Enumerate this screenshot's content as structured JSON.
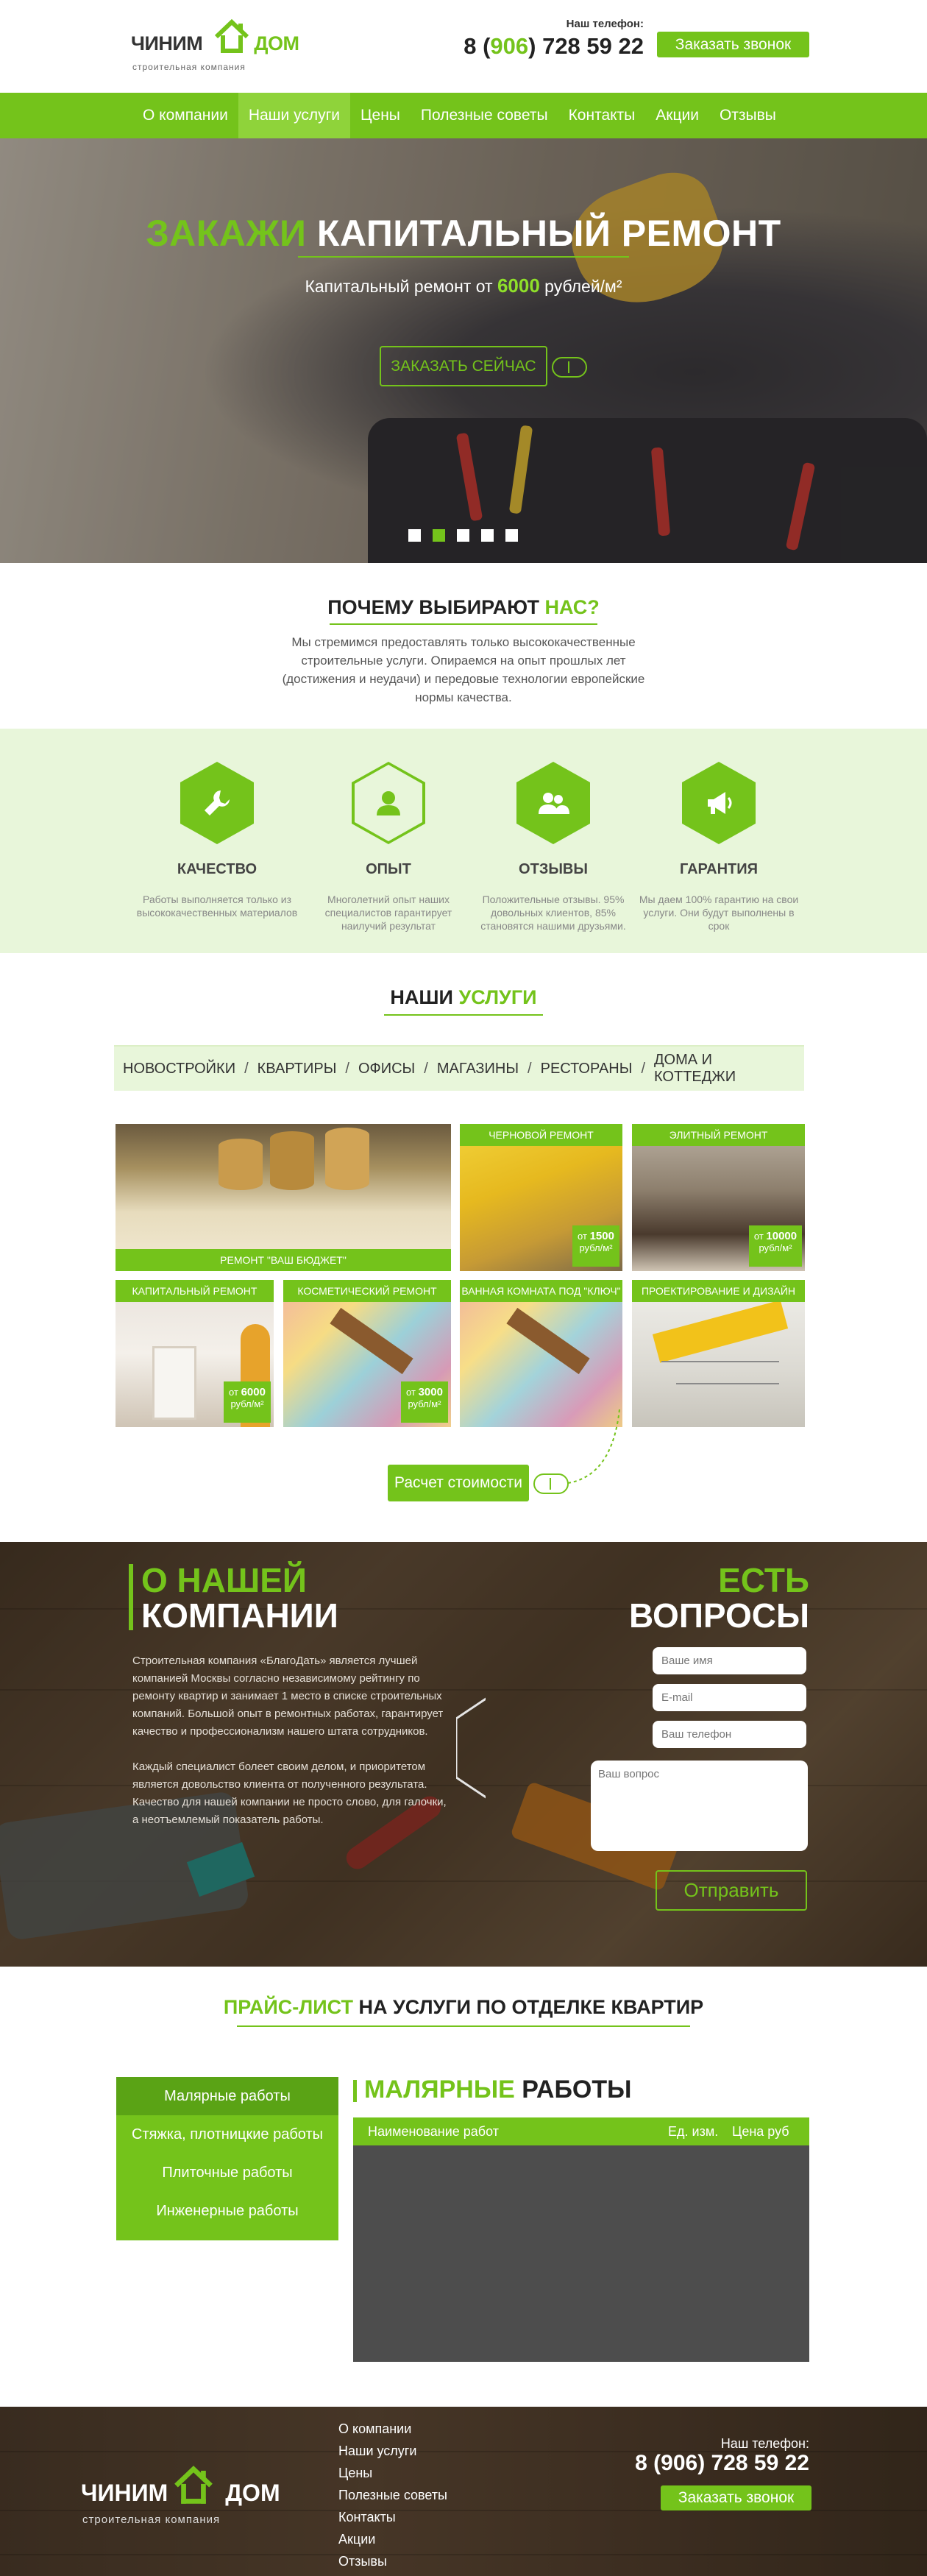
{
  "header": {
    "logo_word1": "ЧИНИМ",
    "logo_word2": "ДОМ",
    "logo_sub": "строительная компания",
    "phone_label": "Наш телефон:",
    "phone_prefix": "8 (",
    "phone_code": "906",
    "phone_rest": ") 728 59 22",
    "call_button": "Заказать звонок"
  },
  "nav": {
    "items": [
      "О компании",
      "Наши услуги",
      "Цены",
      "Полезные советы",
      "Контакты",
      "Акции",
      "Отзывы"
    ],
    "active": "Наши услуги"
  },
  "hero": {
    "title_accent": "ЗАКАЖИ",
    "title_rest": "КАПИТАЛЬНЫЙ РЕМОНТ",
    "sub_prefix": "Капитальный ремонт от",
    "sub_number": "6000",
    "sub_suffix": "рублей/м²",
    "button": "ЗАКАЗАТЬ СЕЙЧАС",
    "slides_total": 5,
    "slide_active": 2
  },
  "why": {
    "title_main": "ПОЧЕМУ ВЫБИРАЮТ",
    "title_accent": "НАС?",
    "text": "Мы стремимся предоставлять только высококачественные строительные услуги. Опираемся на опыт прошлых лет (достижения и неудачи) и передовые технологии европейские нормы качества."
  },
  "features": [
    {
      "icon": "wrench-icon",
      "title": "КАЧЕСТВО",
      "text": "Работы выполняется только из высококачественных материалов"
    },
    {
      "icon": "user-icon",
      "title": "ОПЫТ",
      "text": "Многолетний опыт наших специалистов гарантирует наилучий результат"
    },
    {
      "icon": "users-icon",
      "title": "ОТЗЫВЫ",
      "text": "Положительные отзывы. 95% довольных клиентов, 85% становятся нашими друзьями."
    },
    {
      "icon": "megaphone-icon",
      "title": "ГАРАНТИЯ",
      "text": "Мы даем 100% гарантию на свои услуги. Они будут выполнены в срок"
    }
  ],
  "services": {
    "title_main": "НАШИ",
    "title_accent": "УСЛУГИ",
    "tabs": [
      "НОВОСТРОЙКИ",
      "КВАРТИРЫ",
      "ОФИСЫ",
      "МАГАЗИНЫ",
      "РЕСТОРАНЫ",
      "ДОМА И КОТТЕДЖИ"
    ],
    "tiles": [
      {
        "label": "РЕМОНТ \"ВАШ БЮДЖЕТ\"",
        "price_from": "",
        "price_value": "",
        "price_unit": ""
      },
      {
        "label": "ЧЕРНОВОЙ РЕМОНТ",
        "price_from": "от",
        "price_value": "1500",
        "price_unit": "рубл/м²"
      },
      {
        "label": "ЭЛИТНЫЙ РЕМОНТ",
        "price_from": "от",
        "price_value": "10000",
        "price_unit": "рубл/м²"
      },
      {
        "label": "КАПИТАЛЬНЫЙ РЕМОНТ",
        "price_from": "от",
        "price_value": "6000",
        "price_unit": "рубл/м²"
      },
      {
        "label": "КОСМЕТИЧЕСКИЙ РЕМОНТ",
        "price_from": "от",
        "price_value": "3000",
        "price_unit": "рубл/м²"
      },
      {
        "label": "ВАННАЯ КОМНАТА ПОД \"КЛЮЧ\"",
        "price_from": "",
        "price_value": "",
        "price_unit": ""
      },
      {
        "label": "ПРОЕКТИРОВАНИЕ И ДИЗАЙН",
        "price_from": "",
        "price_value": "",
        "price_unit": ""
      }
    ],
    "calc_button": "Расчет стоимости"
  },
  "about": {
    "title_line1": "О НАШЕЙ",
    "title_line2": "КОМПАНИИ",
    "para1": "Строительная компания «БлагоДать» является лучшей компанией Москвы согласно независимому рейтингу по ремонту квартир и занимает 1 место в списке строительных компаний. Большой опыт в ремонтных работах, гарантирует качество и профессионализм нашего штата сотрудников.",
    "para2": "Каждый специалист болеет своим делом, и приоритетом является довольство клиента от полученного результата. Качество для нашей компании не просто слово, для галочки, а неотъемлемый показатель работы.",
    "q_line1": "ЕСТЬ",
    "q_line2": "ВОПРОСЫ",
    "name_placeholder": "Ваше имя",
    "email_placeholder": "E-mail",
    "phone_placeholder": "Ваш телефон",
    "question_placeholder": "Ваш вопрос",
    "send_button": "Отправить"
  },
  "pricelist": {
    "title_accent": "ПРАЙС-ЛИСТ",
    "title_rest": "НА УСЛУГИ ПО ОТДЕЛКЕ КВАРТИР",
    "menu": [
      "Малярные работы",
      "Стяжка, плотницкие работы",
      "Плиточные работы",
      "Инженерные работы"
    ],
    "menu_active": 0,
    "heading_accent": "МАЛЯРНЫЕ",
    "heading_rest": "РАБОТЫ",
    "col_name": "Наименование работ",
    "col_unit": "Ед. изм.",
    "col_price": "Цена руб"
  },
  "footer": {
    "logo_word1": "ЧИНИМ",
    "logo_word2": "ДОМ",
    "logo_sub": "строительная компания",
    "nav": [
      "О компании",
      "Наши услуги",
      "Цены",
      "Полезные советы",
      "Контакты",
      "Акции",
      "Отзывы"
    ],
    "phone_label": "Наш телефон:",
    "phone": "8 (906) 728 59 22",
    "call_button": "Заказать звонок"
  },
  "colors": {
    "accent": "#74c31b",
    "accent_light": "#e8f6da",
    "dark_table": "#4d4d4d"
  }
}
